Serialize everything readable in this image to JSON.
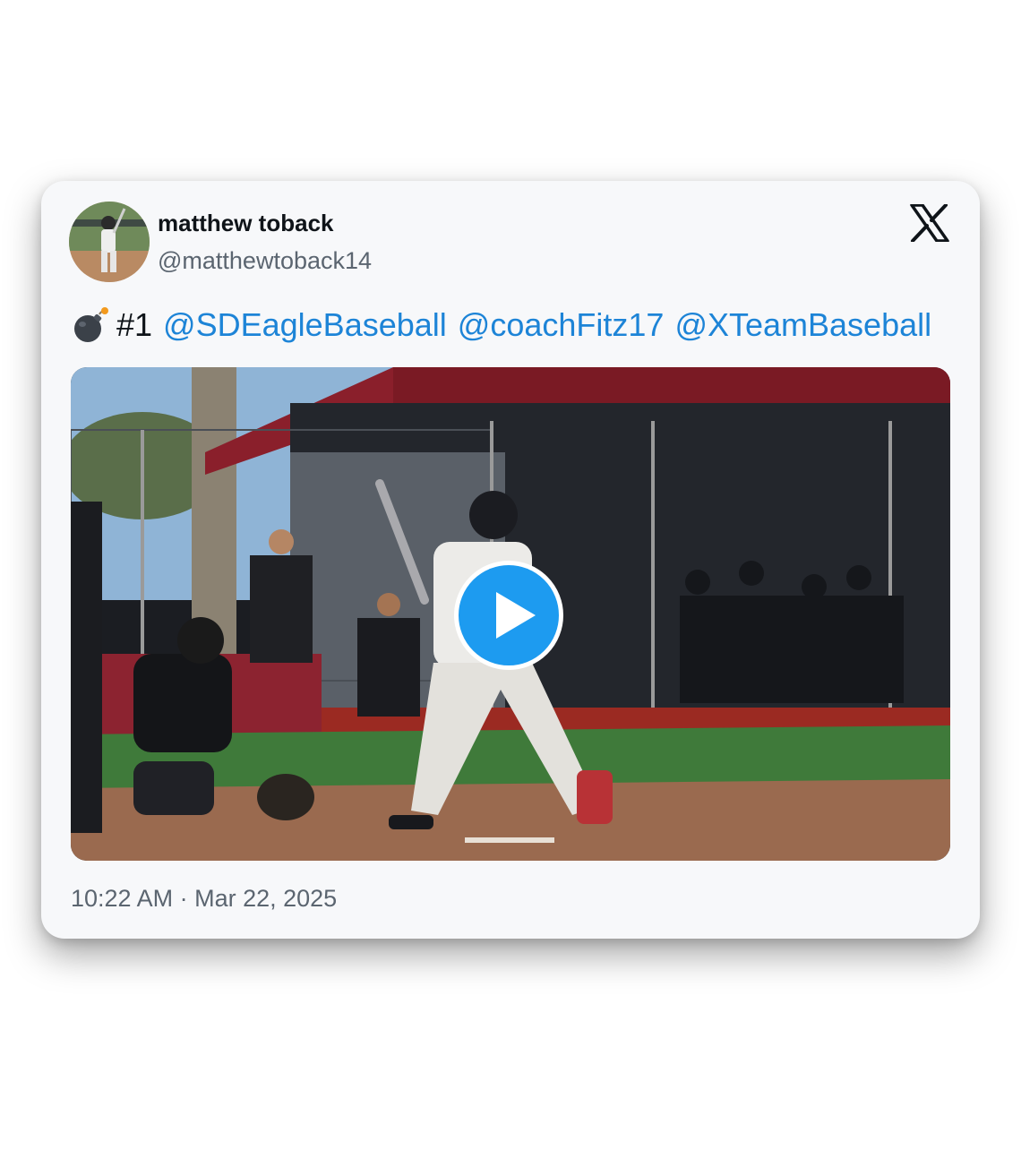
{
  "tweet": {
    "display_name": "matthew toback",
    "handle": "@matthewtoback14",
    "text_emoji_icon": "bomb-icon",
    "text_prefix": "#1",
    "mentions": [
      "@SDEagleBaseball",
      "@coachFitz17",
      "@XTeamBaseball"
    ],
    "timestamp": "10:22 AM · Mar 22, 2025"
  },
  "media": {
    "type": "video",
    "play_icon": "play-icon"
  },
  "colors": {
    "mention": "#1d84d7",
    "play_button": "#1d9bf0",
    "text": "#0f1419",
    "secondary_text": "#5b6570",
    "card_background": "#f7f8fa"
  },
  "icons": {
    "brand": "x-logo-icon",
    "avatar": "avatar"
  }
}
